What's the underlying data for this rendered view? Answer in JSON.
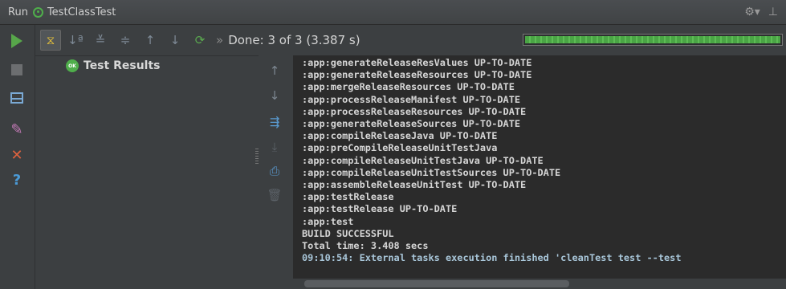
{
  "titlebar": {
    "run_label": "Run",
    "config_name": "TestClassTest",
    "settings_icon": "gear-icon",
    "hide_icon": "hide-panel-icon"
  },
  "toolbar": {
    "status": "Done: 3 of 3",
    "duration": "(3.387 s)",
    "more_glyph": "»",
    "progress": 1.0,
    "progress_color": "#4fae4b"
  },
  "tree": {
    "root_label": "Test Results",
    "root_badge": "OK"
  },
  "console": {
    "lines": [
      ":app:generateReleaseResValues UP-TO-DATE",
      ":app:generateReleaseResources UP-TO-DATE",
      ":app:mergeReleaseResources UP-TO-DATE",
      ":app:processReleaseManifest UP-TO-DATE",
      ":app:processReleaseResources UP-TO-DATE",
      ":app:generateReleaseSources UP-TO-DATE",
      ":app:compileReleaseJava UP-TO-DATE",
      ":app:preCompileReleaseUnitTestJava",
      ":app:compileReleaseUnitTestJava UP-TO-DATE",
      ":app:compileReleaseUnitTestSources UP-TO-DATE",
      ":app:assembleReleaseUnitTest UP-TO-DATE",
      ":app:testRelease",
      ":app:testRelease UP-TO-DATE",
      ":app:test",
      "BUILD SUCCESSFUL",
      "Total time: 3.408 secs"
    ],
    "final_line": "09:10:54: External tasks execution finished 'cleanTest test --test"
  },
  "colors": {
    "background": "#3c3f41",
    "console_bg": "#2b2b2b",
    "success": "#4fae4b"
  }
}
